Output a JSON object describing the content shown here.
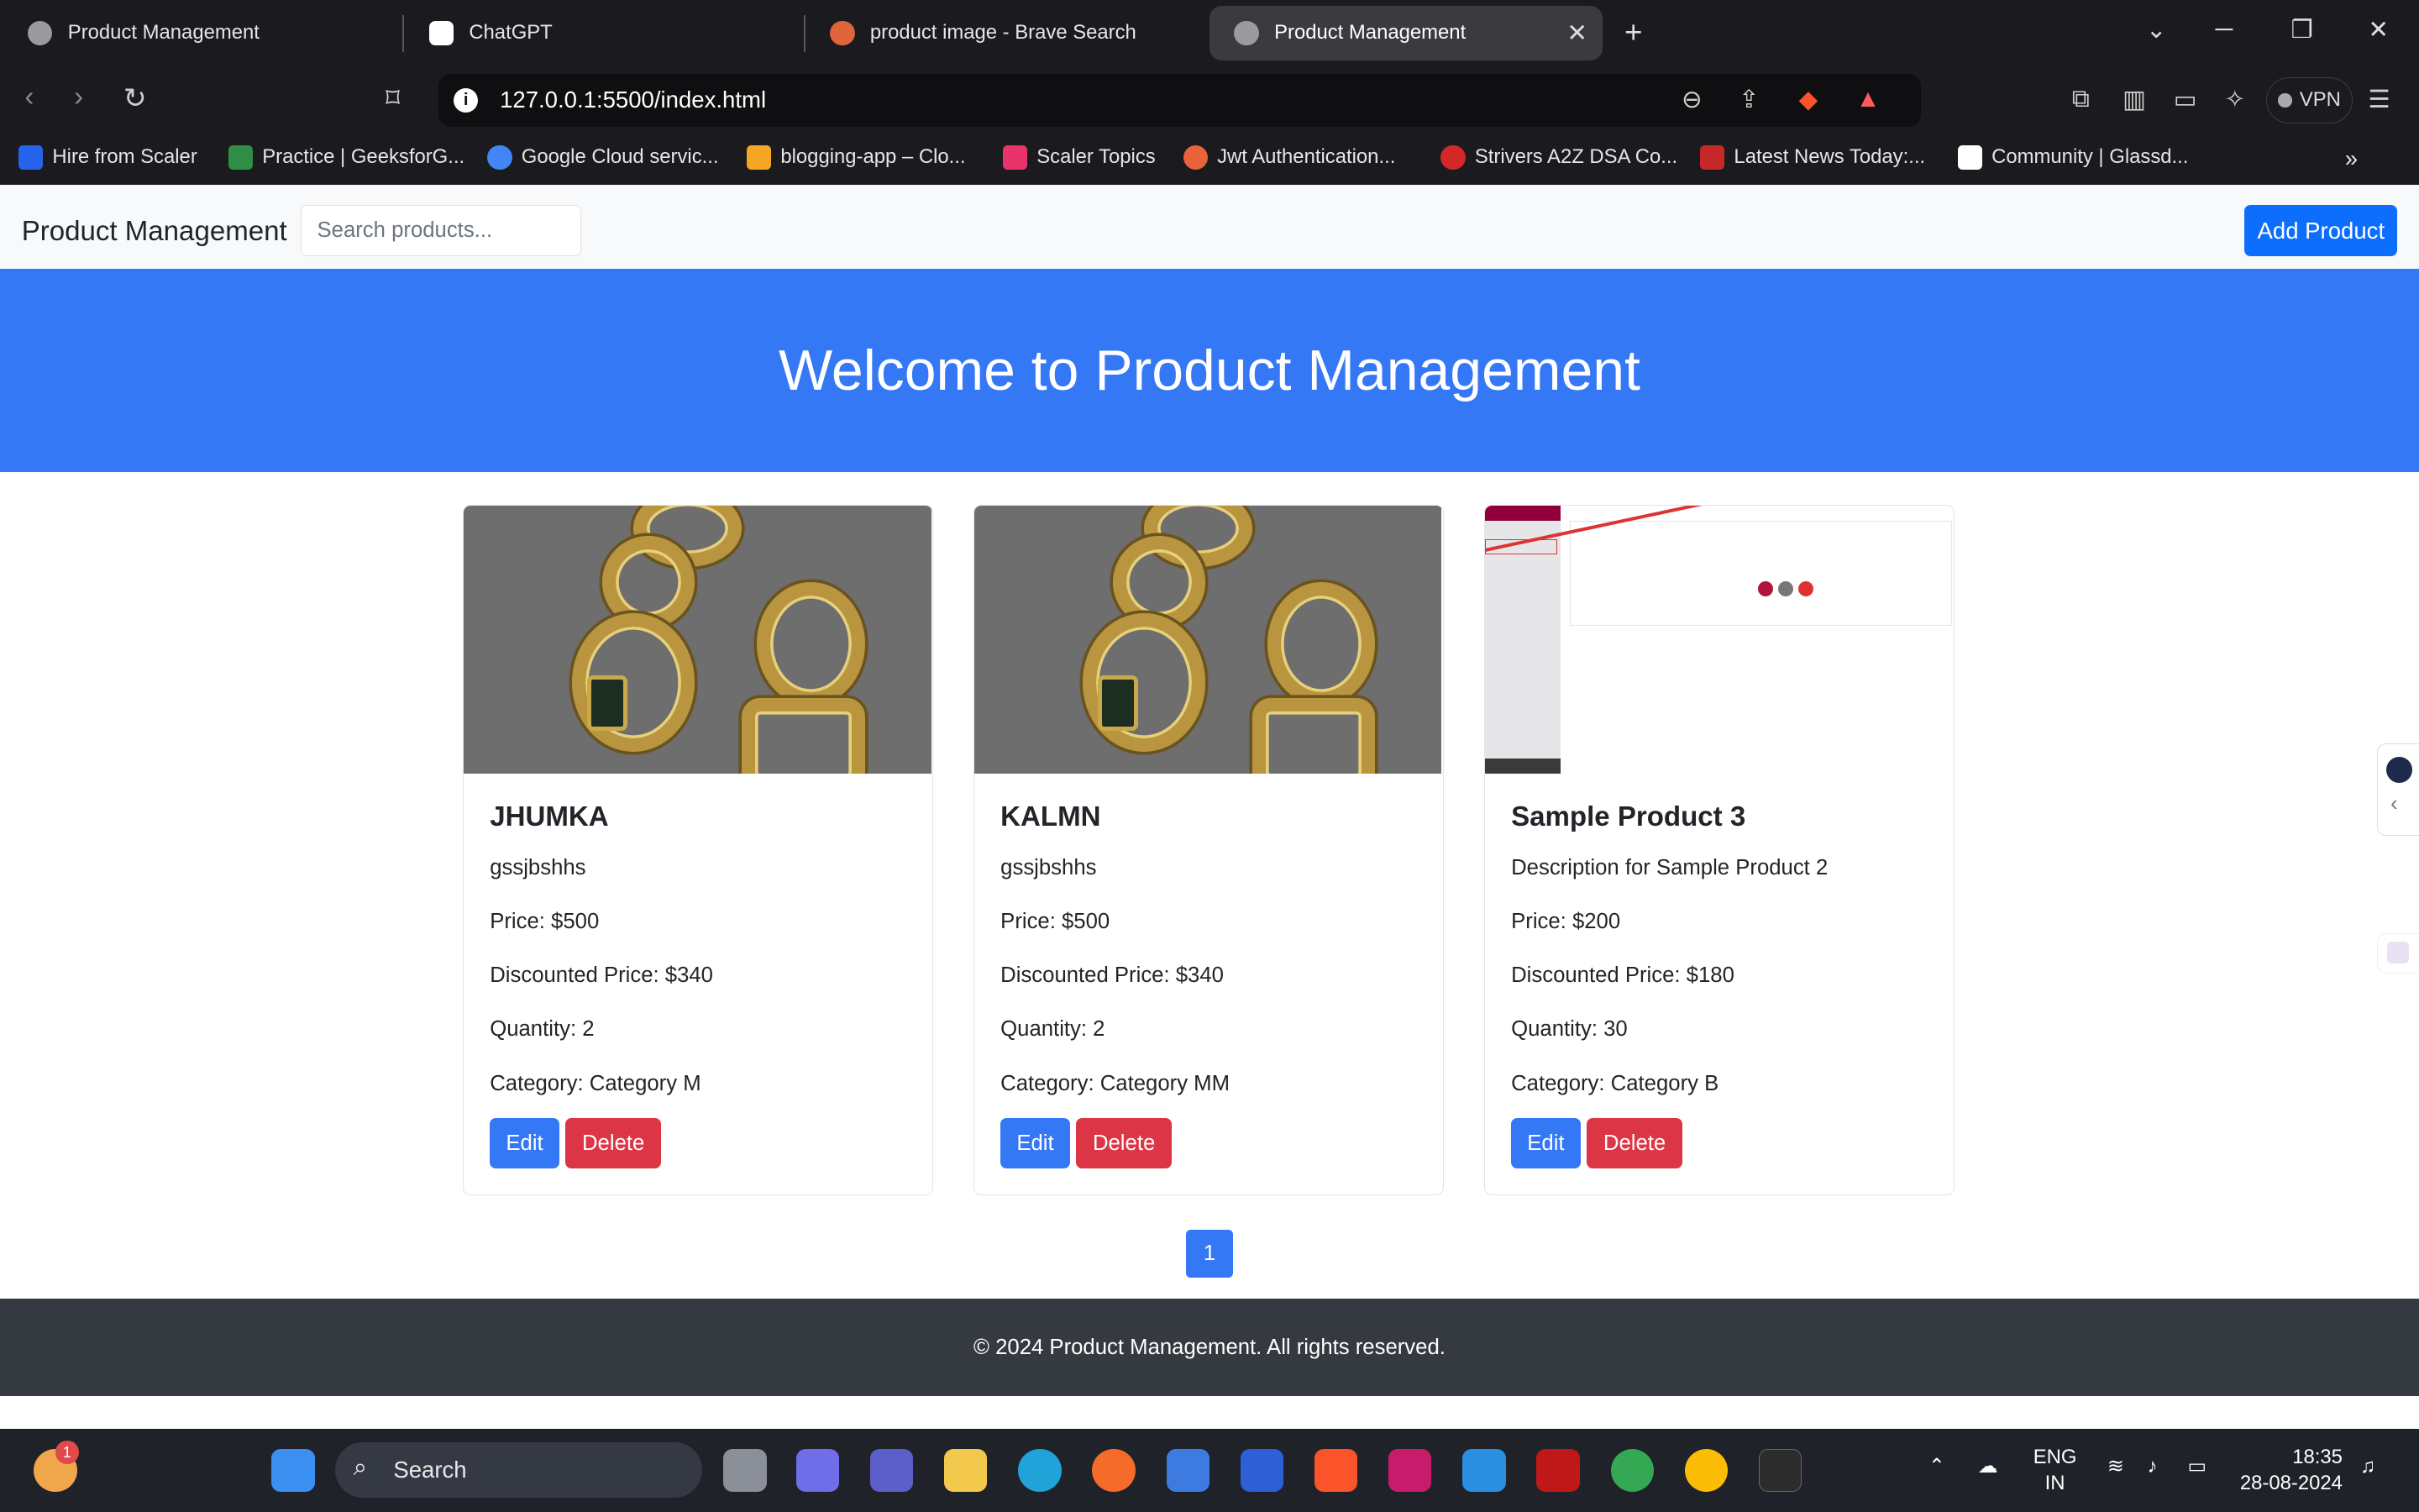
{
  "browser": {
    "tabs": [
      {
        "title": "Product Management",
        "active": false
      },
      {
        "title": "ChatGPT",
        "active": false
      },
      {
        "title": "product image - Brave Search",
        "active": false
      },
      {
        "title": "Product Management",
        "active": true
      }
    ],
    "url": "127.0.0.1:5500/index.html",
    "vpn_label": "VPN",
    "bookmarks": [
      "Hire from Scaler",
      "Practice | GeeksforG...",
      "Google Cloud servic...",
      "blogging-app – Clo...",
      "Scaler Topics",
      "Jwt Authentication...",
      "Strivers A2Z DSA Co...",
      "Latest News Today:...",
      "Community | Glassd..."
    ]
  },
  "app": {
    "brand": "Product Management",
    "search_placeholder": "Search products...",
    "add_button": "Add Product",
    "hero_title": "Welcome to Product Management",
    "products": [
      {
        "name": "JHUMKA",
        "description": "gssjbshhs",
        "price": "Price: $500",
        "discounted": "Discounted Price: $340",
        "quantity": "Quantity: 2",
        "category": "Category: Category M",
        "edit": "Edit",
        "delete": "Delete"
      },
      {
        "name": "KALMN",
        "description": "gssjbshhs",
        "price": "Price: $500",
        "discounted": "Discounted Price: $340",
        "quantity": "Quantity: 2",
        "category": "Category: Category MM",
        "edit": "Edit",
        "delete": "Delete"
      },
      {
        "name": "Sample Product 3",
        "description": "Description for Sample Product 2",
        "price": "Price: $200",
        "discounted": "Discounted Price: $180",
        "quantity": "Quantity: 30",
        "category": "Category: Category B",
        "edit": "Edit",
        "delete": "Delete"
      }
    ],
    "pagination": [
      "1"
    ],
    "footer": "© 2024 Product Management. All rights reserved."
  },
  "taskbar": {
    "search_label": "Search",
    "weather_badge": "1",
    "language": "ENG",
    "region": "IN",
    "time": "18:35",
    "date": "28-08-2024"
  },
  "colors": {
    "primary": "#3478f6",
    "danger": "#dc3545",
    "footer": "#343a40",
    "browser_chrome": "#1b1b1f"
  }
}
